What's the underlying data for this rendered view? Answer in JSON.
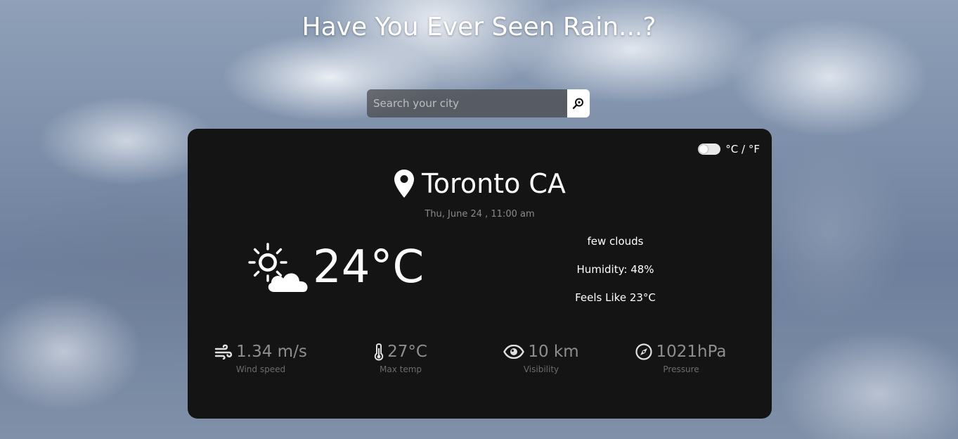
{
  "header": {
    "title": "Have You Ever Seen Rain...?"
  },
  "search": {
    "placeholder": "Search your city",
    "value": "",
    "button_icon": "search-icon"
  },
  "card": {
    "unit_toggle_label": "°C / °F",
    "unit_toggle_state": "celsius",
    "location_icon": "map-pin-icon",
    "city": "Toronto CA",
    "datetime": "Thu, June 24 , 11:00 am",
    "weather_icon": "partly-cloudy-day-icon",
    "temperature": "24°C",
    "description": "few clouds",
    "humidity": "Humidity: 48%",
    "feels_like": "Feels Like 23°C",
    "stats": [
      {
        "icon": "wind-icon",
        "value": "1.34 m/s",
        "label": "Wind speed"
      },
      {
        "icon": "thermometer-icon",
        "value": "27°C",
        "label": "Max temp"
      },
      {
        "icon": "eye-icon",
        "value": "10 km",
        "label": "Visibility"
      },
      {
        "icon": "compass-icon",
        "value": "1021hPa",
        "label": "Pressure"
      }
    ]
  },
  "colors": {
    "card_background": "#141414",
    "muted_text": "#8e8e8e",
    "label_text": "#6c6c6c"
  }
}
